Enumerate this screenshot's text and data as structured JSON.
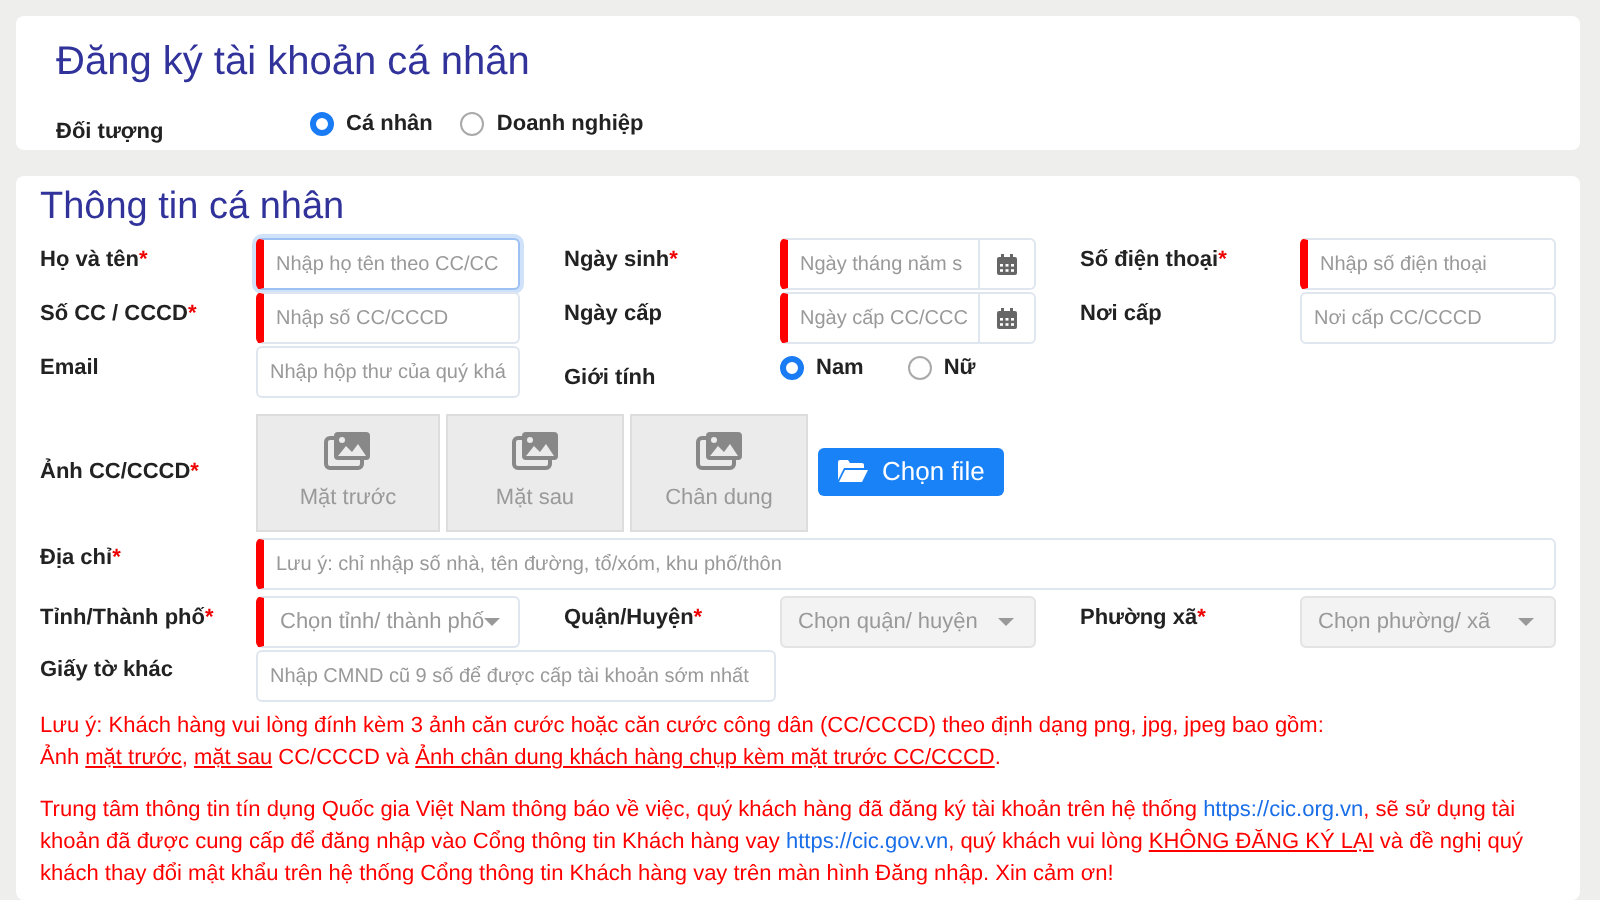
{
  "registration": {
    "title": "Đăng ký tài khoản cá nhân",
    "subject": {
      "label": "Đối tượng",
      "options": [
        {
          "label": "Cá nhân",
          "selected": true
        },
        {
          "label": "Doanh nghiệp",
          "selected": false
        }
      ]
    }
  },
  "personal_info": {
    "title": "Thông tin cá nhân",
    "rows": [
      [
        {
          "kind": "text",
          "label": "Họ và tên",
          "required_mark": "*",
          "placeholder": "Nhập họ tên theo CC/CC",
          "marker": true,
          "focused": true
        },
        {
          "kind": "date",
          "label": "Ngày sinh",
          "required_mark": "*",
          "placeholder": "Ngày tháng năm s",
          "marker": true
        },
        {
          "kind": "text",
          "label": "Số điện thoại",
          "required_mark": "*",
          "placeholder": "Nhập số điện thoại",
          "marker": true
        }
      ],
      [
        {
          "kind": "text",
          "label": "Số CC / CCCD",
          "required_mark": "*",
          "placeholder": "Nhập số CC/CCCD",
          "marker": true
        },
        {
          "kind": "date",
          "label": "Ngày cấp",
          "placeholder": "Ngày cấp CC/CCC",
          "marker": true
        },
        {
          "kind": "text",
          "label": "Nơi cấp",
          "placeholder": "Nơi cấp CC/CCCD",
          "marker": false
        }
      ],
      [
        {
          "kind": "text",
          "label": "Email",
          "placeholder": "Nhập hộp thư của quý khá",
          "marker": false
        },
        {
          "kind": "radio",
          "label": "Giới tính",
          "options": [
            {
              "label": "Nam",
              "selected": true
            },
            {
              "label": "Nữ",
              "selected": false
            }
          ]
        }
      ],
      [
        {
          "kind": "photos",
          "label": "Ảnh CC/CCCD",
          "required_mark": "*",
          "tiles": [
            "Mặt trước",
            "Mặt sau",
            "Chân dung"
          ],
          "button": "Chọn file"
        }
      ],
      [
        {
          "kind": "wide",
          "label": "Địa chỉ",
          "required_mark": "*",
          "placeholder": "Lưu ý: chỉ nhập số nhà, tên đường, tổ/xóm, khu phố/thôn",
          "marker": true
        }
      ],
      [
        {
          "kind": "select",
          "label": "Tỉnh/Thành phố",
          "required_mark": "*",
          "placeholder": "Chọn tỉnh/ thành phố",
          "marker": true,
          "disabled": false
        },
        {
          "kind": "select",
          "label": "Quận/Huyện",
          "required_mark": "*",
          "placeholder": "Chọn quận/ huyện",
          "marker": false,
          "disabled": true
        },
        {
          "kind": "select",
          "label": "Phường xã",
          "required_mark": "*",
          "placeholder": "Chọn phường/ xã",
          "marker": false,
          "disabled": true
        }
      ],
      [
        {
          "kind": "medium",
          "label": "Giấy tờ khác",
          "placeholder": "Nhập CMND cũ 9 số để được cấp tài khoản sớm nhất",
          "marker": false
        }
      ]
    ],
    "notes": [
      {
        "lines": [
          [
            {
              "kind": "plain",
              "text": "Lưu ý: Khách hàng vui lòng đính kèm 3 ảnh căn cước hoặc căn cước công dân (CC/CCCD) theo định dạng png, jpg, jpeg bao gồm:"
            }
          ],
          [
            {
              "kind": "plain",
              "text": "Ảnh "
            },
            {
              "kind": "underline",
              "text": "mặt trước",
              "tail": ", "
            },
            {
              "kind": "underline",
              "text": "mặt sau",
              "tail": " CC/CCCD và "
            },
            {
              "kind": "underline",
              "text": "Ảnh chân dung khách hàng chụp kèm mặt trước CC/CCCD",
              "tail": "."
            }
          ]
        ]
      },
      {
        "lines": [
          [
            {
              "kind": "plain",
              "text": "Trung tâm thông tin tín dụng Quốc gia Việt Nam thông báo về việc, quý khách hàng đã đăng ký tài khoản trên hệ thống "
            },
            {
              "kind": "link",
              "text": "https://cic.org.vn"
            },
            {
              "kind": "plain",
              "text": ", sẽ sử dụng tài khoản đã được cung cấp để đăng nhập vào Cổng thông tin Khách hàng vay "
            },
            {
              "kind": "link",
              "text": "https://cic.gov.vn"
            },
            {
              "kind": "plain",
              "text": ", quý khách vui lòng "
            },
            {
              "kind": "underline",
              "text": "KHÔNG ĐĂNG KÝ LẠI"
            },
            {
              "kind": "plain",
              "text": " và đề nghị quý khách thay đổi mật khẩu trên hệ thống Cổng thông tin Khách hàng vay trên màn hình Đăng nhập. Xin cảm ơn!"
            }
          ]
        ]
      }
    ]
  }
}
